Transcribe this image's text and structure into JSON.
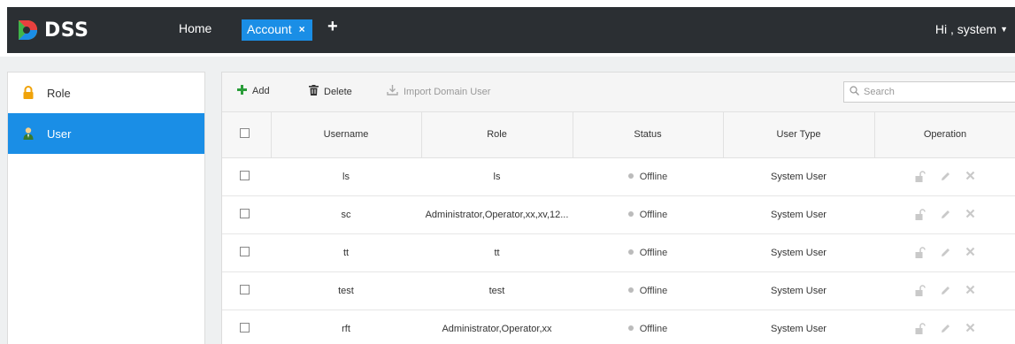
{
  "header": {
    "logo_text": "DSS",
    "home_label": "Home",
    "active_tab_label": "Account",
    "tab_close_symbol": "×",
    "add_tab_symbol": "+",
    "user_greeting": "Hi , system",
    "caret_symbol": "▼"
  },
  "sidebar": {
    "items": [
      {
        "label": "Role",
        "icon": "lock-icon",
        "active": false
      },
      {
        "label": "User",
        "icon": "user-icon",
        "active": true
      }
    ]
  },
  "toolbar": {
    "add_label": "Add",
    "delete_label": "Delete",
    "import_label": "Import Domain User",
    "search_placeholder": "Search"
  },
  "table": {
    "columns": [
      "Username",
      "Role",
      "Status",
      "User Type",
      "Operation"
    ],
    "rows": [
      {
        "username": "ls",
        "role": "ls",
        "status": "Offline",
        "user_type": "System User"
      },
      {
        "username": "sc",
        "role": "Administrator,Operator,xx,xv,12...",
        "status": "Offline",
        "user_type": "System User"
      },
      {
        "username": "tt",
        "role": "tt",
        "status": "Offline",
        "user_type": "System User"
      },
      {
        "username": "test",
        "role": "test",
        "status": "Offline",
        "user_type": "System User"
      },
      {
        "username": "rft",
        "role": "Administrator,Operator,xx",
        "status": "Offline",
        "user_type": "System User"
      }
    ]
  },
  "colors": {
    "topbar_bg": "#2b2f33",
    "accent_blue": "#1a8ee6",
    "add_green": "#2a9d3a",
    "offline_dot": "#bbbbbb"
  }
}
